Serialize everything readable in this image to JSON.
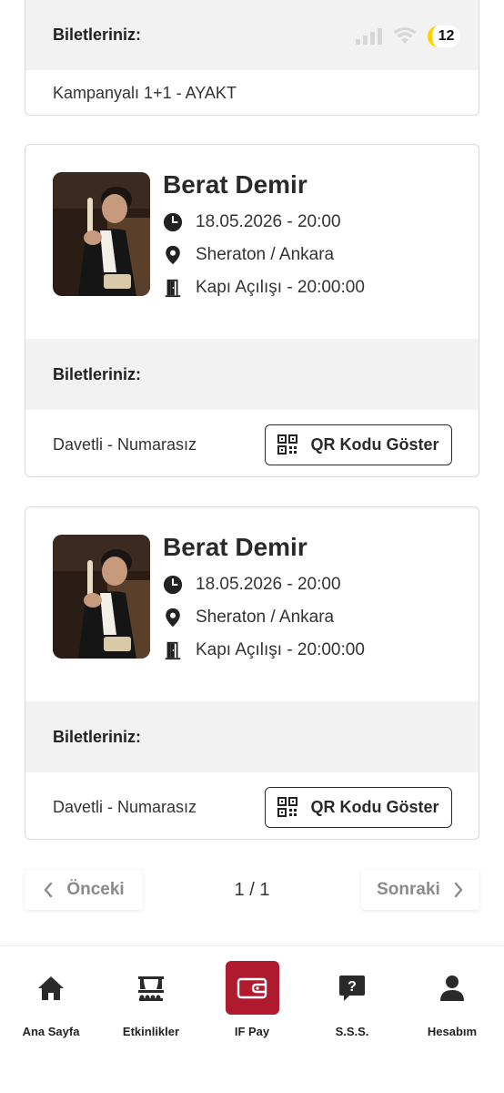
{
  "status_bar": {
    "battery": "12"
  },
  "top_card": {
    "tickets_header": "Biletleriniz:",
    "ticket_type": "Kampanyalı 1+1 - AYAKT"
  },
  "events": [
    {
      "artist": "Berat Demir",
      "datetime": "18.05.2026 - 20:00",
      "venue": "Sheraton / Ankara",
      "doors": "Kapı Açılışı - 20:00:00",
      "tickets_header": "Biletleriniz:",
      "ticket_type": "Davetli - Numarasız",
      "qr_label": "QR Kodu Göster"
    },
    {
      "artist": "Berat Demir",
      "datetime": "18.05.2026 - 20:00",
      "venue": "Sheraton / Ankara",
      "doors": "Kapı Açılışı - 20:00:00",
      "tickets_header": "Biletleriniz:",
      "ticket_type": "Davetli - Numarasız",
      "qr_label": "QR Kodu Göster"
    }
  ],
  "pagination": {
    "prev": "Önceki",
    "page_count": "1 / 1",
    "next": "Sonraki"
  },
  "bottom_nav": [
    {
      "label": "Ana Sayfa",
      "icon": "home-icon"
    },
    {
      "label": "Etkinlikler",
      "icon": "stage-icon"
    },
    {
      "label": "IF Pay",
      "icon": "wallet-icon"
    },
    {
      "label": "S.S.S.",
      "icon": "faq-icon"
    },
    {
      "label": "Hesabım",
      "icon": "user-icon"
    }
  ],
  "colors": {
    "accent": "#b01a2e",
    "battery": "#ffd200"
  }
}
